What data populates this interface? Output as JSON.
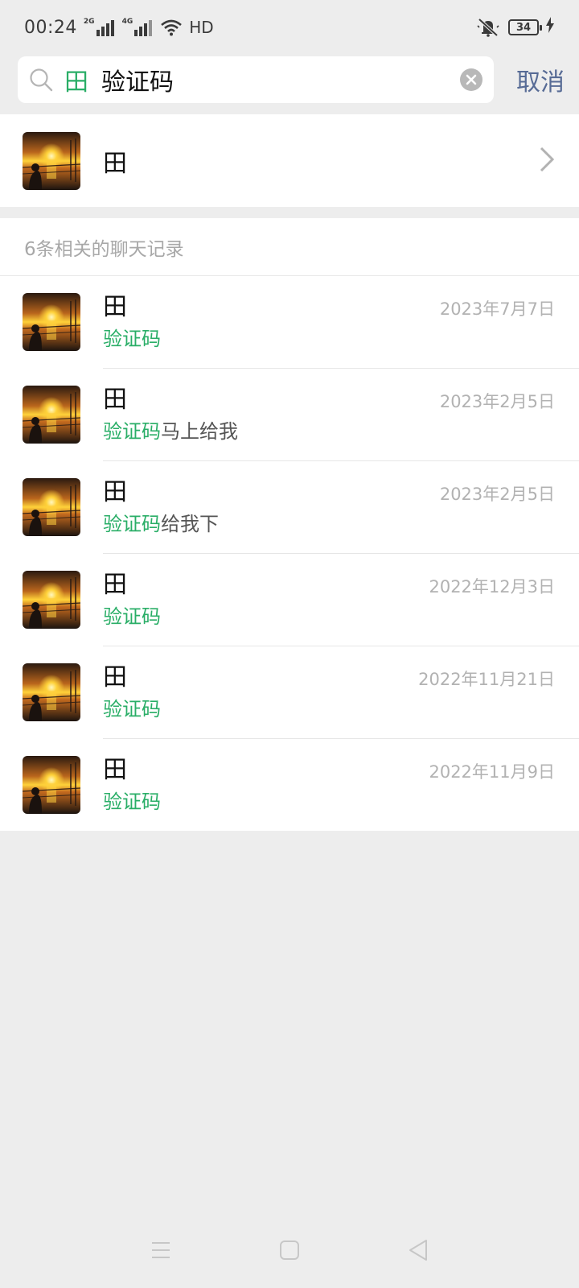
{
  "status_bar": {
    "time": "00:24",
    "sim1_tag": "2G",
    "sim2_tag": "4G",
    "hd_label": "HD",
    "battery": "34"
  },
  "search": {
    "contact_tag": "田",
    "query": "验证码",
    "cancel_label": "取消"
  },
  "contact_result": {
    "name": "田"
  },
  "records": {
    "header": "6条相关的聊天记录",
    "highlight_color": "#2aae67",
    "items": [
      {
        "name": "田",
        "date": "2023年7月7日",
        "match": "验证码",
        "rest": ""
      },
      {
        "name": "田",
        "date": "2023年2月5日",
        "match": "验证码",
        "rest": "马上给我"
      },
      {
        "name": "田",
        "date": "2023年2月5日",
        "match": "验证码",
        "rest": "给我下"
      },
      {
        "name": "田",
        "date": "2022年12月3日",
        "match": "验证码",
        "rest": ""
      },
      {
        "name": "田",
        "date": "2022年11月21日",
        "match": "验证码",
        "rest": ""
      },
      {
        "name": "田",
        "date": "2022年11月9日",
        "match": "验证码",
        "rest": ""
      }
    ]
  },
  "icons": [
    "search-icon",
    "clear-icon",
    "chevron-right-icon",
    "mute-icon",
    "wifi-icon",
    "charging-icon",
    "menu-icon",
    "home-icon",
    "back-icon"
  ]
}
